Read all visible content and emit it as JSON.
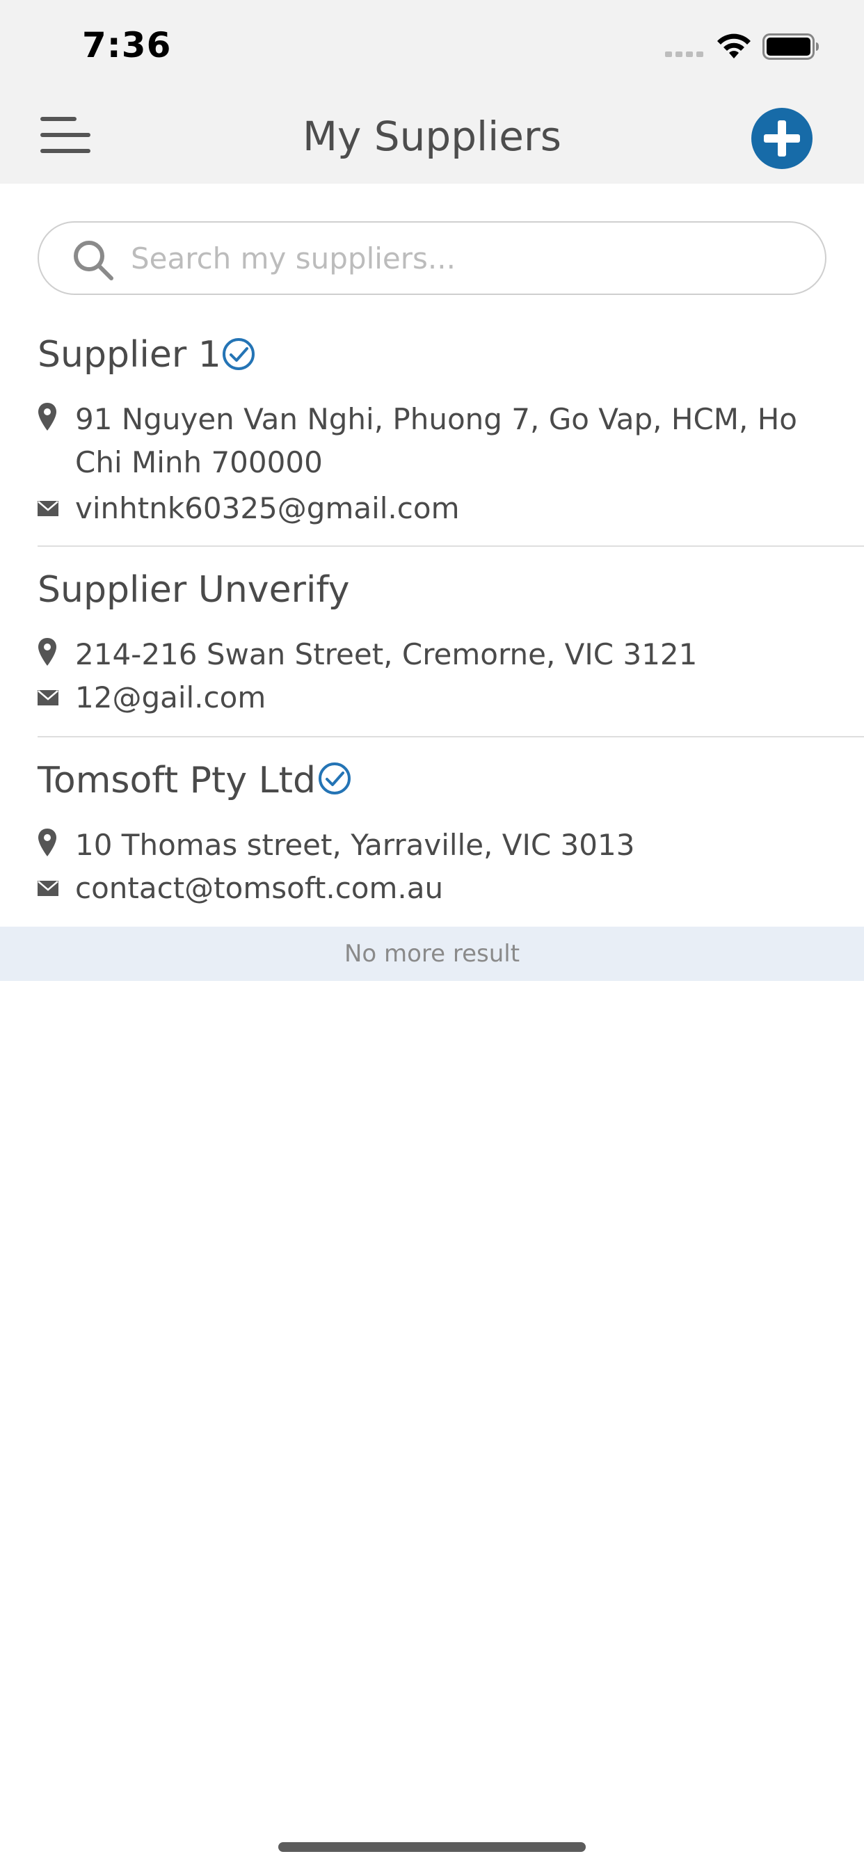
{
  "status_bar": {
    "time": "7:36"
  },
  "header": {
    "title": "My Suppliers",
    "menu_icon": "hamburger-menu-icon",
    "add_icon": "plus-circle-icon",
    "accent_color": "#176ba8"
  },
  "search": {
    "placeholder": "Search my suppliers...",
    "value": "",
    "icon": "search-icon"
  },
  "suppliers": [
    {
      "name": "Supplier 1",
      "verified": true,
      "address": "91 Nguyen Van Nghi, Phuong 7, Go Vap, HCM, Ho Chi Minh 700000",
      "email": "vinhtnk60325@gmail.com"
    },
    {
      "name": "Supplier Unverify",
      "verified": false,
      "address": "214-216 Swan Street, Cremorne, VIC 3121",
      "email": "12@gail.com"
    },
    {
      "name": "Tomsoft Pty Ltd",
      "verified": true,
      "address": "10 Thomas street, Yarraville, VIC 3013",
      "email": "contact@tomsoft.com.au"
    }
  ],
  "footer": {
    "no_more_text": "No more result"
  }
}
